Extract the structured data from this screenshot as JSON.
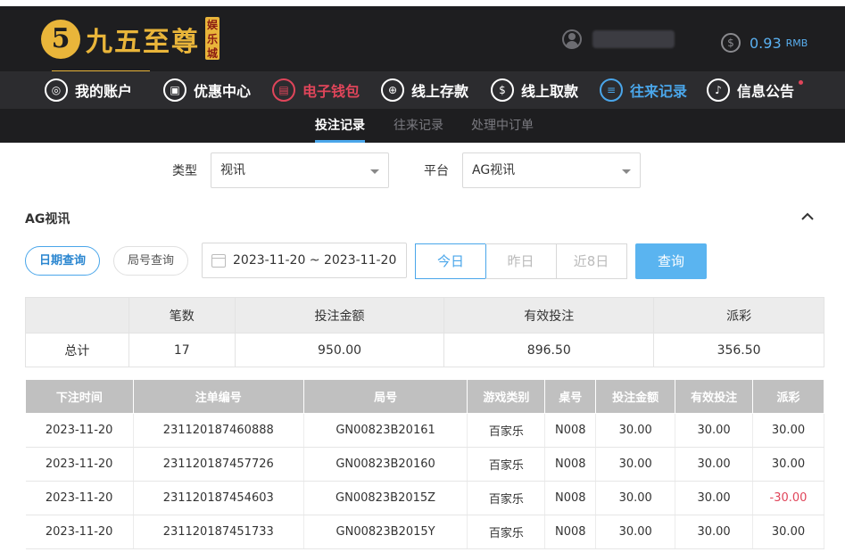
{
  "brand": {
    "mark": "5",
    "name": "九五至尊",
    "badge": "娱乐城"
  },
  "user": {
    "balance": "0.93",
    "currency": "RMB"
  },
  "nav": {
    "items": [
      {
        "label": "我的账户",
        "icon": "user-circle-icon"
      },
      {
        "label": "优惠中心",
        "icon": "gift-icon"
      },
      {
        "label": "电子钱包",
        "icon": "wallet-icon"
      },
      {
        "label": "线上存款",
        "icon": "deposit-icon"
      },
      {
        "label": "线上取款",
        "icon": "withdraw-icon"
      },
      {
        "label": "往来记录",
        "icon": "records-icon"
      },
      {
        "label": "信息公告",
        "icon": "bell-icon"
      }
    ]
  },
  "subnav": {
    "tabs": [
      "投注记录",
      "往来记录",
      "处理中订单"
    ]
  },
  "filters": {
    "type_label": "类型",
    "type_value": "视讯",
    "platform_label": "平台",
    "platform_value": "AG视讯"
  },
  "section": {
    "title": "AG视讯"
  },
  "query": {
    "date_query": "日期查询",
    "round_query": "局号查询",
    "date_range": "2023-11-20 ~ 2023-11-20",
    "today": "今日",
    "yesterday": "昨日",
    "last8": "近8日",
    "search": "查询"
  },
  "summary": {
    "headers": [
      "",
      "笔数",
      "投注金额",
      "有效投注",
      "派彩"
    ],
    "row": [
      "总计",
      "17",
      "950.00",
      "896.50",
      "356.50"
    ]
  },
  "detail": {
    "headers": [
      "下注时间",
      "注单编号",
      "局号",
      "游戏类别",
      "桌号",
      "投注金额",
      "有效投注",
      "派彩"
    ],
    "rows": [
      [
        "2023-11-20",
        "231120187460888",
        "GN00823B20161",
        "百家乐",
        "N008",
        "30.00",
        "30.00",
        "30.00"
      ],
      [
        "2023-11-20",
        "231120187457726",
        "GN00823B20160",
        "百家乐",
        "N008",
        "30.00",
        "30.00",
        "30.00"
      ],
      [
        "2023-11-20",
        "231120187454603",
        "GN00823B2015Z",
        "百家乐",
        "N008",
        "30.00",
        "30.00",
        "-30.00"
      ],
      [
        "2023-11-20",
        "231120187451733",
        "GN00823B2015Y",
        "百家乐",
        "N008",
        "30.00",
        "30.00",
        "30.00"
      ]
    ]
  },
  "colors": {
    "accent": "#4aa6ea",
    "negative": "#e0455a",
    "gold": "#e9b53a"
  }
}
